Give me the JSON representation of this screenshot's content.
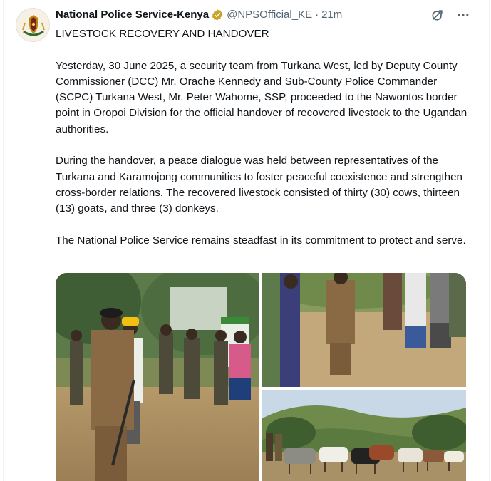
{
  "post": {
    "author_name": "National Police Service-Kenya",
    "handle": "@NPSOfficial_KE",
    "separator": "·",
    "time": "21m",
    "verified_icon": "verified-badge-icon",
    "paragraphs": [
      "LIVESTOCK RECOVERY AND HANDOVER",
      "Yesterday, 30 June 2025, a security team from Turkana West, led by Deputy County Commissioner (DCC) Mr. Orache Kennedy and Sub-County Police Commander (SCPC) Turkana West, Mr. Peter Wahome, SSP, proceeded to the Nawontos border point in Oropoi Division for the official handover of recovered livestock to the Ugandan authorities.",
      "During the handover, a peace dialogue was held between representatives of the Turkana and Karamojong communities to foster peaceful coexistence and strengthen cross-border relations. The recovered livestock consisted of thirty (30) cows, thirteen (13) goats, and three (3) donkeys.",
      "The National Police Service remains steadfast in its commitment to protect and serve."
    ]
  },
  "actions": {
    "grok_icon": "grok-icon",
    "more_icon": "more-options-icon"
  },
  "media": {
    "photos": [
      "photo-officials-speaking",
      "photo-officers-standing",
      "photo-livestock-herd"
    ]
  },
  "colors": {
    "text": "#0f1419",
    "secondary": "#536471",
    "verified_gold": "#c9a227"
  }
}
